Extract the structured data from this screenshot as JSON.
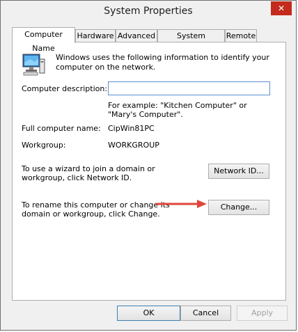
{
  "window": {
    "title": "System Properties",
    "close_glyph": "✕"
  },
  "tabs": [
    "Computer Name",
    "Hardware",
    "Advanced",
    "System Protection",
    "Remote"
  ],
  "intro_text": "Windows uses the following information to identify your computer on the network.",
  "description": {
    "label": "Computer description:",
    "value": "",
    "example": "For example: \"Kitchen Computer\" or \"Mary's Computer\"."
  },
  "full_name": {
    "label": "Full computer name:",
    "value": "CipWin81PC"
  },
  "workgroup": {
    "label": "Workgroup:",
    "value": "WORKGROUP"
  },
  "network_id": {
    "text": "To use a wizard to join a domain or workgroup, click Network ID.",
    "button": "Network ID..."
  },
  "rename": {
    "text": "To rename this computer or change its domain or workgroup, click Change.",
    "button": "Change..."
  },
  "footer": {
    "ok": "OK",
    "cancel": "Cancel",
    "apply": "Apply"
  },
  "colors": {
    "close_bg": "#c42b1c",
    "arrow": "#e0463b",
    "input_border": "#5a8fd0"
  },
  "icons": [
    "computer-icon",
    "close-icon",
    "arrow-annotation-icon"
  ]
}
